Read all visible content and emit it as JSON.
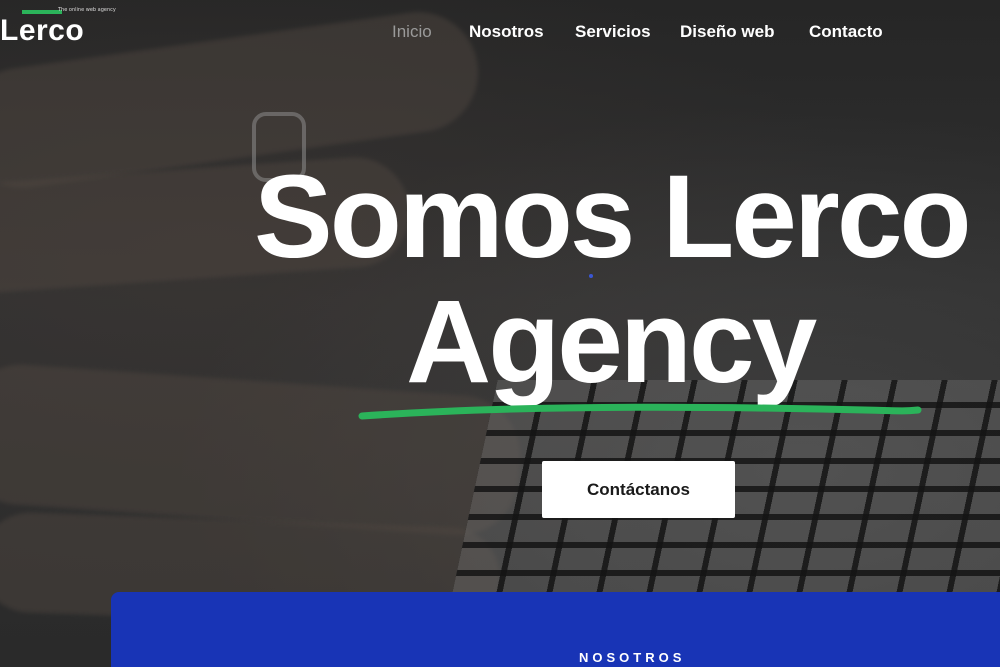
{
  "brand": {
    "name": "Lerco",
    "tagline": "The online web agency",
    "accent_color": "#2bb35a"
  },
  "nav": {
    "items": [
      {
        "label": "Inicio",
        "active": true
      },
      {
        "label": "Nosotros",
        "active": false
      },
      {
        "label": "Servicios",
        "active": false
      },
      {
        "label": "Diseño web",
        "active": false
      },
      {
        "label": "Contacto",
        "active": false
      }
    ]
  },
  "hero": {
    "headline_line1": "Somos Lerco",
    "headline_line2": "Agency",
    "underline_color": "#2bb35a",
    "cta_label": "Contáctanos"
  },
  "section": {
    "label": "NOSOTROS",
    "background_color": "#1834b6"
  }
}
